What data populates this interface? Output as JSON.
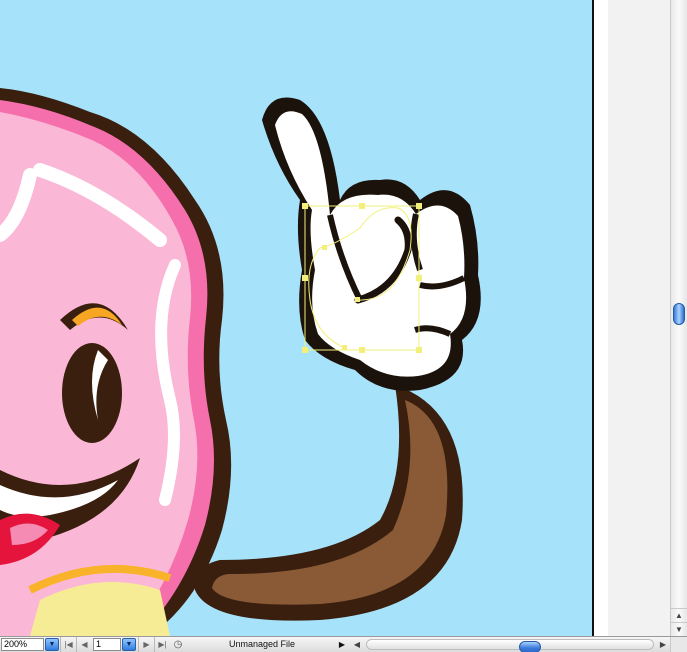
{
  "document": {
    "status_text": "Unmanaged File",
    "colors": {
      "artboard_bg": "#a6e3fa",
      "icing_pink": "#fbb7d6",
      "outline_dark": "#3a1f0e",
      "arm_brown": "#8a5a36",
      "selection": "#f2f07a"
    }
  },
  "statusbar": {
    "zoom_value": "200%",
    "zoom_menu_icon": "triangle-down",
    "first_page_icon": "first-page",
    "prev_page_icon": "prev-page",
    "page_value": "1",
    "page_menu_icon": "triangle-down",
    "next_page_icon": "next-page",
    "last_page_icon": "last-page",
    "status_icon": "clock-icon",
    "status_menu_icon": "triangle-right"
  },
  "scroll": {
    "horizontal_position": 0.5,
    "vertical_position": 0.48
  }
}
